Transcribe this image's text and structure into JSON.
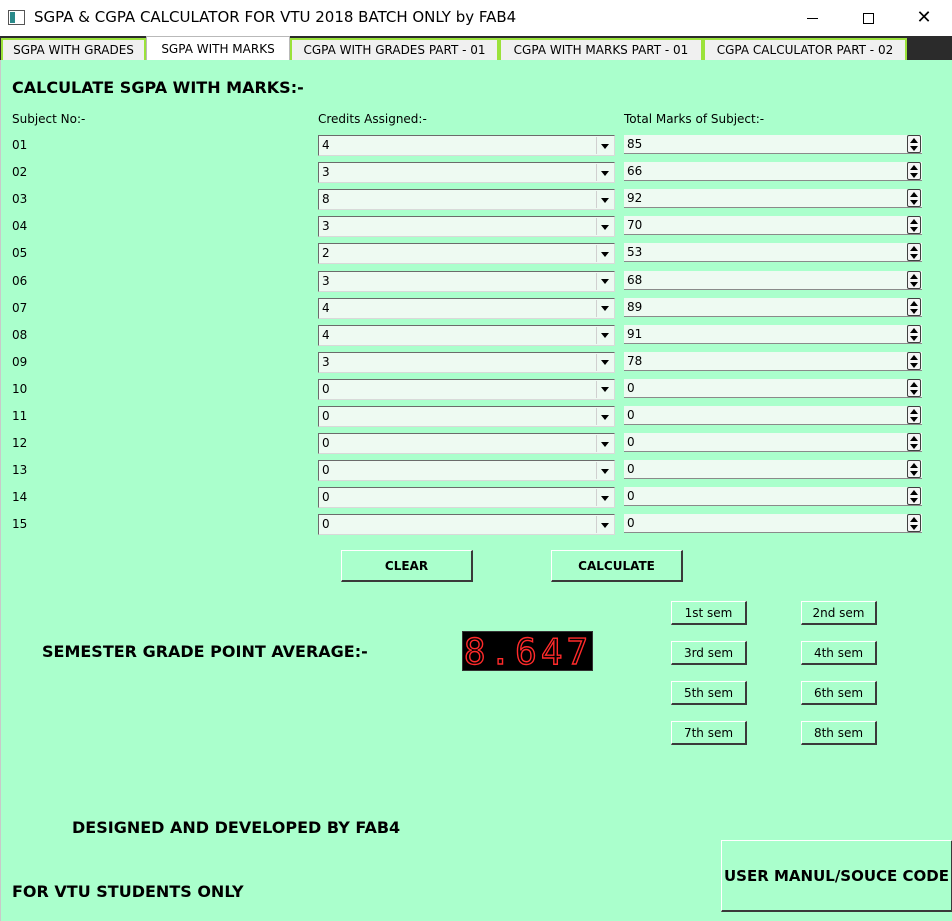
{
  "window": {
    "title": "SGPA & CGPA CALCULATOR FOR VTU 2018 BATCH ONLY by FAB4",
    "minimize": "—",
    "maximize": "☐",
    "close": "✕"
  },
  "tabs": [
    {
      "label": "SGPA WITH GRADES"
    },
    {
      "label": "SGPA WITH MARKS"
    },
    {
      "label": "CGPA WITH GRADES PART - 01"
    },
    {
      "label": "CGPA WITH MARKS PART - 01"
    },
    {
      "label": "CGPA CALCULATOR PART - 02"
    }
  ],
  "selected_tab": "SGPA WITH MARKS",
  "main": {
    "heading": "CALCULATE SGPA WITH MARKS:-",
    "col_subject": "Subject No:-",
    "col_credits": "Credits Assigned:-",
    "col_marks": "Total Marks of Subject:-",
    "rows": [
      {
        "no": "01",
        "credits": "4",
        "marks": "85"
      },
      {
        "no": "02",
        "credits": "3",
        "marks": "66"
      },
      {
        "no": "03",
        "credits": "8",
        "marks": "92"
      },
      {
        "no": "04",
        "credits": "3",
        "marks": "70"
      },
      {
        "no": "05",
        "credits": "2",
        "marks": "53"
      },
      {
        "no": "06",
        "credits": "3",
        "marks": "68"
      },
      {
        "no": "07",
        "credits": "4",
        "marks": "89"
      },
      {
        "no": "08",
        "credits": "4",
        "marks": "91"
      },
      {
        "no": "09",
        "credits": "3",
        "marks": "78"
      },
      {
        "no": "10",
        "credits": "0",
        "marks": "0"
      },
      {
        "no": "11",
        "credits": "0",
        "marks": "0"
      },
      {
        "no": "12",
        "credits": "0",
        "marks": "0"
      },
      {
        "no": "13",
        "credits": "0",
        "marks": "0"
      },
      {
        "no": "14",
        "credits": "0",
        "marks": "0"
      },
      {
        "no": "15",
        "credits": "0",
        "marks": "0"
      }
    ],
    "clear_label": "CLEAR",
    "calculate_label": "CALCULATE",
    "sgpa_label": "SEMESTER GRADE POINT AVERAGE:-",
    "sgpa_value": "8.647",
    "sem_buttons": [
      "1st sem",
      "2nd sem",
      "3rd sem",
      "4th sem",
      "5th sem",
      "6th sem",
      "7th sem",
      "8th sem"
    ],
    "designed_by": "DESIGNED AND DEVELOPED BY FAB4",
    "vtu_only": "FOR VTU STUDENTS ONLY",
    "manual_label": "USER MANUL/SOUCE CODE"
  },
  "colors": {
    "panel_bg": "#aaffcc",
    "lcd_bg": "#000000",
    "lcd_digit": "#ff2020",
    "tab_outline": "#9be23a"
  },
  "icons": {
    "app": "app-window-icon",
    "minimize": "minimize-icon",
    "maximize": "maximize-icon",
    "close": "close-icon",
    "dropdown": "chevron-down-icon",
    "spin_up": "spin-up-icon",
    "spin_down": "spin-down-icon"
  }
}
